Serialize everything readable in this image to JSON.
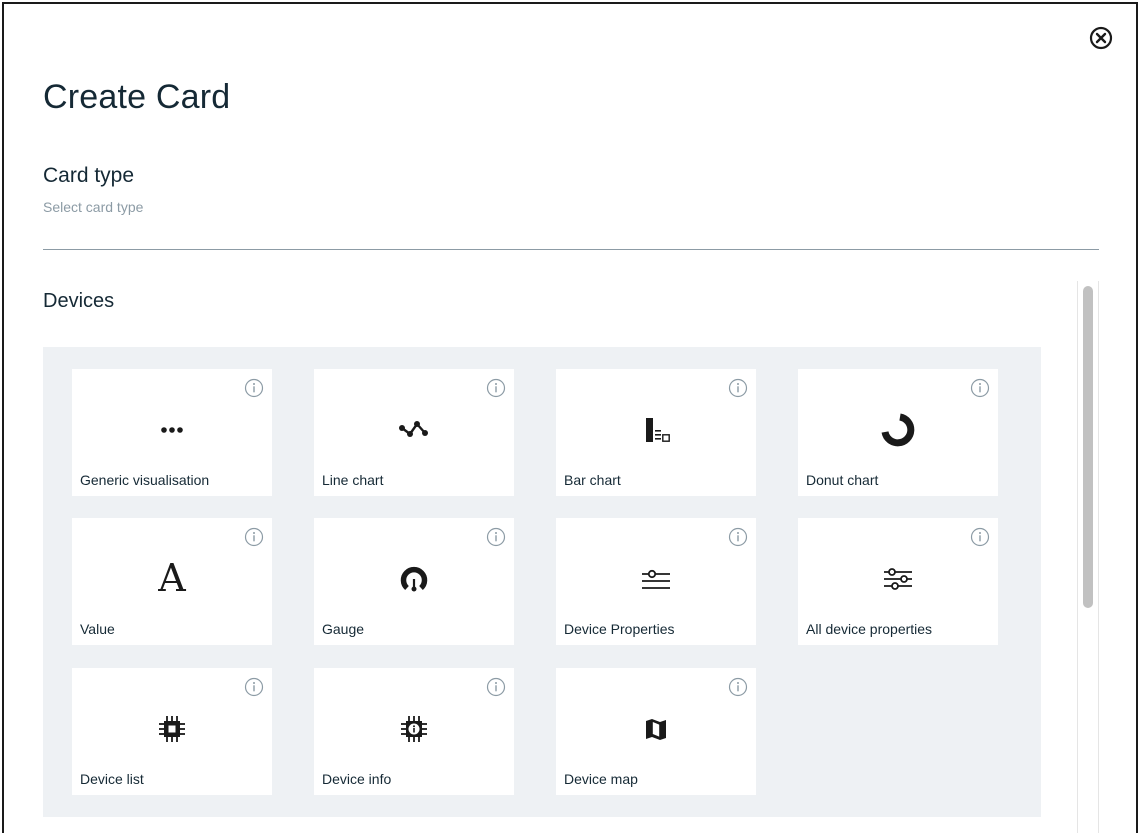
{
  "dialog": {
    "title": "Create Card",
    "close_icon": "close-circle-icon",
    "section_title": "Card type",
    "section_subtitle": "Select card type",
    "group_title": "Devices"
  },
  "cards": [
    {
      "label": "Generic visualisation",
      "icon": "more-dots-icon"
    },
    {
      "label": "Line chart",
      "icon": "line-chart-icon"
    },
    {
      "label": "Bar chart",
      "icon": "bar-chart-icon"
    },
    {
      "label": "Donut chart",
      "icon": "donut-chart-icon"
    },
    {
      "label": "Value",
      "icon": "value-letter-icon"
    },
    {
      "label": "Gauge",
      "icon": "gauge-icon"
    },
    {
      "label": "Device Properties",
      "icon": "properties-slider-icon"
    },
    {
      "label": "All device properties",
      "icon": "all-properties-sliders-icon"
    },
    {
      "label": "Device list",
      "icon": "chip-icon"
    },
    {
      "label": "Device info",
      "icon": "chip-info-icon"
    },
    {
      "label": "Device map",
      "icon": "map-icon"
    }
  ]
}
